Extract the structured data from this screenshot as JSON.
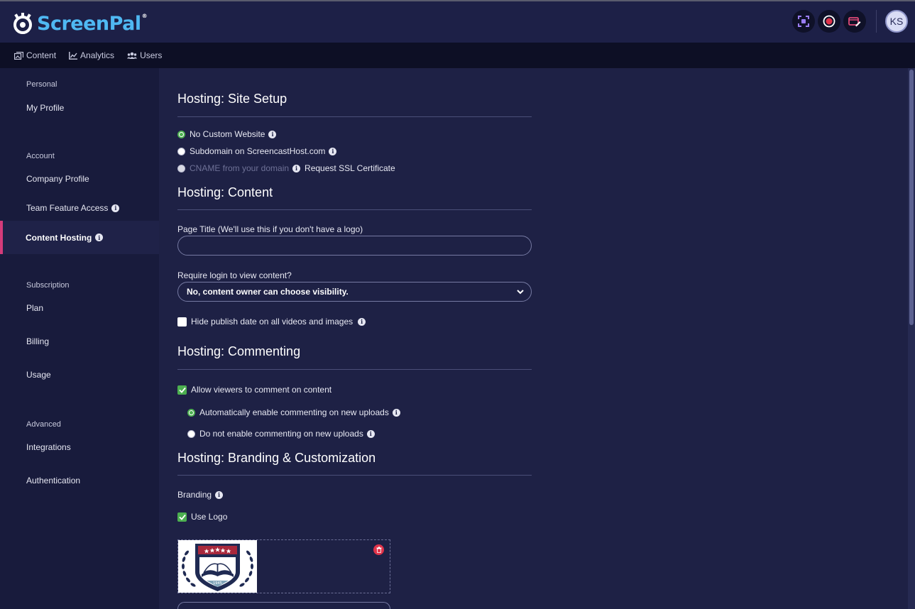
{
  "header": {
    "logo_text": "ScreenPal",
    "logo_reg": "®",
    "avatar_initials": "KS",
    "icons": [
      "screenshot-icon",
      "record-icon",
      "video-editor-icon"
    ]
  },
  "nav": {
    "items": [
      {
        "label": "Content",
        "icon": "content-icon"
      },
      {
        "label": "Analytics",
        "icon": "analytics-icon"
      },
      {
        "label": "Users",
        "icon": "users-icon"
      }
    ]
  },
  "sidebar": {
    "personal": "Personal",
    "my_profile": "My Profile",
    "account": "Account",
    "company_profile": "Company Profile",
    "team_feature_access": "Team Feature Access",
    "content_hosting": "Content Hosting",
    "subscription": "Subscription",
    "plan": "Plan",
    "billing": "Billing",
    "usage": "Usage",
    "advanced": "Advanced",
    "integrations": "Integrations",
    "authentication": "Authentication"
  },
  "site_setup": {
    "title": "Hosting: Site Setup",
    "no_custom": "No Custom Website",
    "subdomain": "Subdomain on ScreencastHost.com",
    "cname": "CNAME from your domain",
    "ssl": "Request SSL Certificate"
  },
  "content": {
    "title": "Hosting: Content",
    "page_title_label": "Page Title (We'll use this if you don't have a logo)",
    "page_title_value": "",
    "require_login_label": "Require login to view content?",
    "require_login_value": "No, content owner can choose visibility.",
    "hide_publish": "Hide publish date on all videos and images"
  },
  "commenting": {
    "title": "Hosting: Commenting",
    "allow": "Allow viewers to comment on content",
    "auto_enable": "Automatically enable commenting on new uploads",
    "no_enable": "Do not enable commenting on new uploads"
  },
  "branding": {
    "title": "Hosting: Branding & Customization",
    "branding_label": "Branding",
    "use_logo": "Use Logo",
    "logo_year": "1945"
  },
  "colors": {
    "accent_green": "#4caf50",
    "active_bar": "#d43b7a",
    "brand_blue": "#4fb8f2",
    "delete_red": "#e0334a"
  }
}
